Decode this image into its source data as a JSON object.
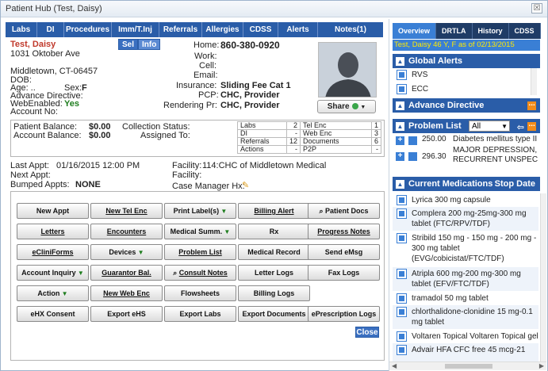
{
  "window": {
    "title": "Patient Hub (Test, Daisy)",
    "close_label": "☒"
  },
  "tabs": [
    "Labs",
    "DI",
    "Procedures",
    "Imm/T.Inj",
    "Referrals",
    "Allergies",
    "CDSS",
    "Alerts",
    "Notes(1)"
  ],
  "patient": {
    "name": "Test, Daisy",
    "sel_label": "Sel",
    "info_label": "Info",
    "address1": "1031 Oktober Ave",
    "city": "Middletown, CT-06457",
    "dob_label": "DOB:",
    "age_label": "Age: ..",
    "sex_label": "Sex:",
    "sex": "F",
    "advance_directive_label": "Advance Directive:",
    "web_enabled_label": "WebEnabled:",
    "web_enabled": "Yes",
    "account_no_label": "Account No:",
    "home_label": "Home:",
    "home_phone": "860-380-0920",
    "work_label": "Work:",
    "cell_label": "Cell:",
    "email_label": "Email:",
    "insurance_label": "Insurance:",
    "insurance": "Sliding Fee Cat 1",
    "pcp_label": "PCP:",
    "pcp": "CHC, Provider",
    "rendering_label": "Rendering Pr:",
    "rendering": "CHC, Provider",
    "share_label": "Share"
  },
  "balances": {
    "patient_balance_label": "Patient Balance:",
    "patient_balance": "$0.00",
    "account_balance_label": "Account Balance:",
    "account_balance": "$0.00",
    "collection_status_label": "Collection Status:",
    "assigned_to_label": "Assigned To:"
  },
  "counts": [
    [
      "Labs",
      "2",
      "Tel Enc",
      "1"
    ],
    [
      "DI",
      "-",
      "Web Enc",
      "3"
    ],
    [
      "Referrals",
      "12",
      "Documents",
      "6"
    ],
    [
      "Actions",
      "-",
      "P2P",
      "-"
    ]
  ],
  "appointments": {
    "last_appt_label": "Last Appt:",
    "last_appt": "01/16/2015 12:00 PM",
    "next_appt_label": "Next Appt:",
    "bumped_label": "Bumped Appts:",
    "bumped": "NONE",
    "facility_label": "Facility:",
    "facility": "114:CHC of Middletown  Medical",
    "facility2_label": "Facility:",
    "case_manager_label": "Case Manager Hx:"
  },
  "buttons": [
    [
      "New Appt",
      "New Tel Enc",
      "Print Label(s)",
      "Billing Alert",
      "Patient Docs"
    ],
    [
      "Letters",
      "Encounters",
      "Medical Summ.",
      "Rx",
      "Progress Notes"
    ],
    [
      "eCliniForms",
      "Devices",
      "Problem List",
      "Medical Record",
      "Send eMsg"
    ],
    [
      "Account Inquiry",
      "Guarantor Bal.",
      "Consult Notes",
      "Letter Logs",
      "Fax Logs"
    ],
    [
      "Action",
      "New Web Enc",
      "Flowsheets",
      "Billing Logs",
      ""
    ],
    [
      "eHX Consent",
      "Export eHS",
      "Export Labs",
      "Export Documents",
      "ePrescription Logs"
    ]
  ],
  "close_label": "Close",
  "right_pane": {
    "tabs": [
      "Overview",
      "DRTLA",
      "History",
      "CDSS"
    ],
    "subtitle": "Test, Daisy 46 Y, F as of 02/13/2015",
    "global_alerts_title": "Global Alerts",
    "global_alerts": [
      "RVS",
      "ECC"
    ],
    "advance_directive_title": "Advance Directive",
    "problem_list_title": "Problem List",
    "problem_filter": "All",
    "problems": [
      {
        "code": "250.00",
        "desc": "Diabetes mellitus type II"
      },
      {
        "code": "296.30",
        "desc": "MAJOR DEPRESSION, RECURRENT UNSPEC"
      }
    ],
    "medications_title": "Current Medications",
    "stop_date_label": "Stop Date",
    "medications": [
      "Lyrica 300 mg capsule",
      "Complera 200 mg-25mg-300 mg tablet (FTC/RPV/TDF)",
      "Stribild 150 mg - 150 mg - 200 mg - 300 mg tablet (EVG/cobicistat/FTC/TDF)",
      "Atripla 600 mg-200 mg-300 mg tablet (EFV/FTC/TDF)",
      "tramadol 50 mg tablet",
      "chlorthalidone-clonidine 15 mg-0.1 mg tablet",
      "Voltaren Topical Voltaren Topical gel",
      "Advair HFA CFC free 45 mcg-21"
    ]
  }
}
